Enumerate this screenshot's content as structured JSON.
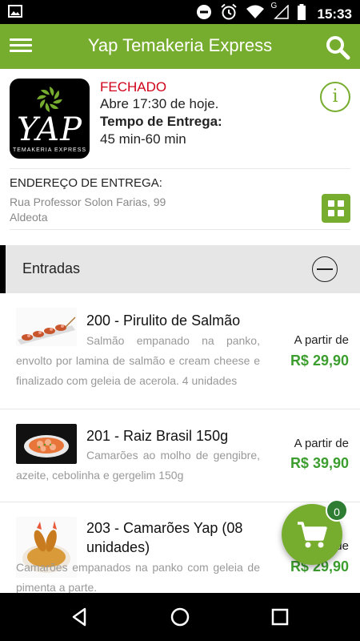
{
  "status_bar": {
    "time": "15:33",
    "icons": [
      "image-icon",
      "do-not-disturb-icon",
      "alarm-icon",
      "wifi-icon",
      "signal-icon",
      "battery-icon"
    ],
    "network_letter": "G"
  },
  "toolbar": {
    "title": "Yap Temakeria Express",
    "menu_icon": "menu-icon",
    "search_icon": "search-icon"
  },
  "store": {
    "logo_text": "YAP",
    "logo_subtext": "TEMAKERIA EXPRESS",
    "status": "FECHADO",
    "opens": "Abre 17:30 de hoje.",
    "delivery_time_label": "Tempo de Entrega:",
    "delivery_time": "45 min-60 min",
    "address_label": "ENDEREÇO DE ENTREGA:",
    "address_line1": "Rua Professor Solon Farias, 99",
    "address_line2": "Aldeota"
  },
  "category": {
    "title": "Entradas"
  },
  "items": [
    {
      "title": "200 - Pirulito de Salmão",
      "description": "Salmão empanado na panko, envolto por lamina de salmão e cream cheese e finalizado com geleia de acerola. 4 unidades",
      "price_prefix": "A partir de",
      "price": "R$ 29,90"
    },
    {
      "title": "201 - Raiz Brasil 150g",
      "description": "Camarões ao molho de gengibre, azeite, cebolinha e gergelim 150g",
      "price_prefix": "A partir de",
      "price": "R$ 39,90"
    },
    {
      "title": "203 - Camarões Yap (08 unidades)",
      "description": "Camarões empanados na panko com geleia de pimenta a parte.",
      "price_prefix": "A partir de",
      "price": "R$ 29,90"
    }
  ],
  "cart": {
    "count": "0",
    "icon": "cart-icon"
  },
  "colors": {
    "brand_green": "#77ad2e",
    "price_green": "#3c9e2f",
    "closed_red": "#d0021b"
  }
}
